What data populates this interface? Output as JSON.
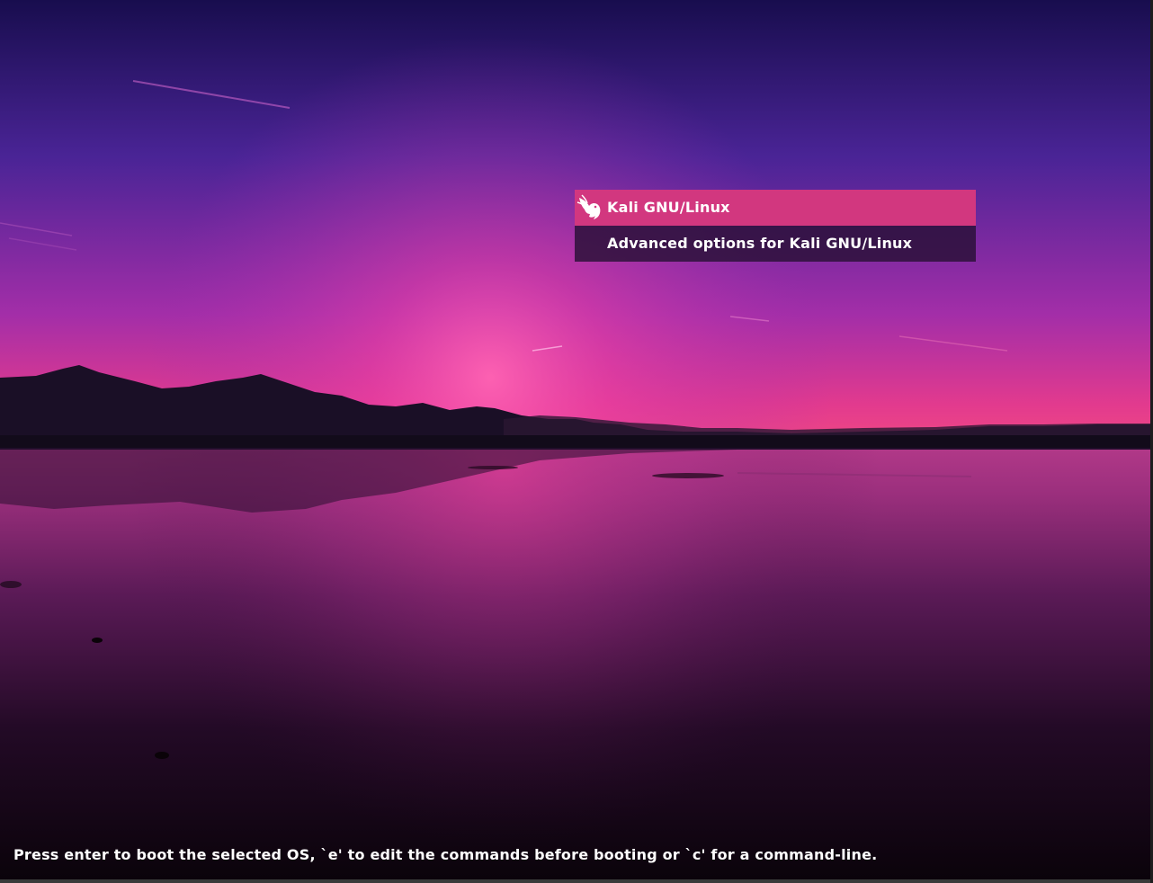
{
  "bootloader": {
    "entries": [
      {
        "label": "Kali GNU/Linux",
        "icon": "kali-dragon-icon",
        "selected": true
      },
      {
        "label": "Advanced options for Kali GNU/Linux",
        "icon": "",
        "selected": false
      }
    ],
    "hint": "Press enter to boot the selected OS, `e' to edit the commands before booting or `c' for a command-line."
  },
  "colors": {
    "selected_entry": "#d2377f",
    "unselected_entry": "#281036",
    "text": "#ffffff"
  }
}
